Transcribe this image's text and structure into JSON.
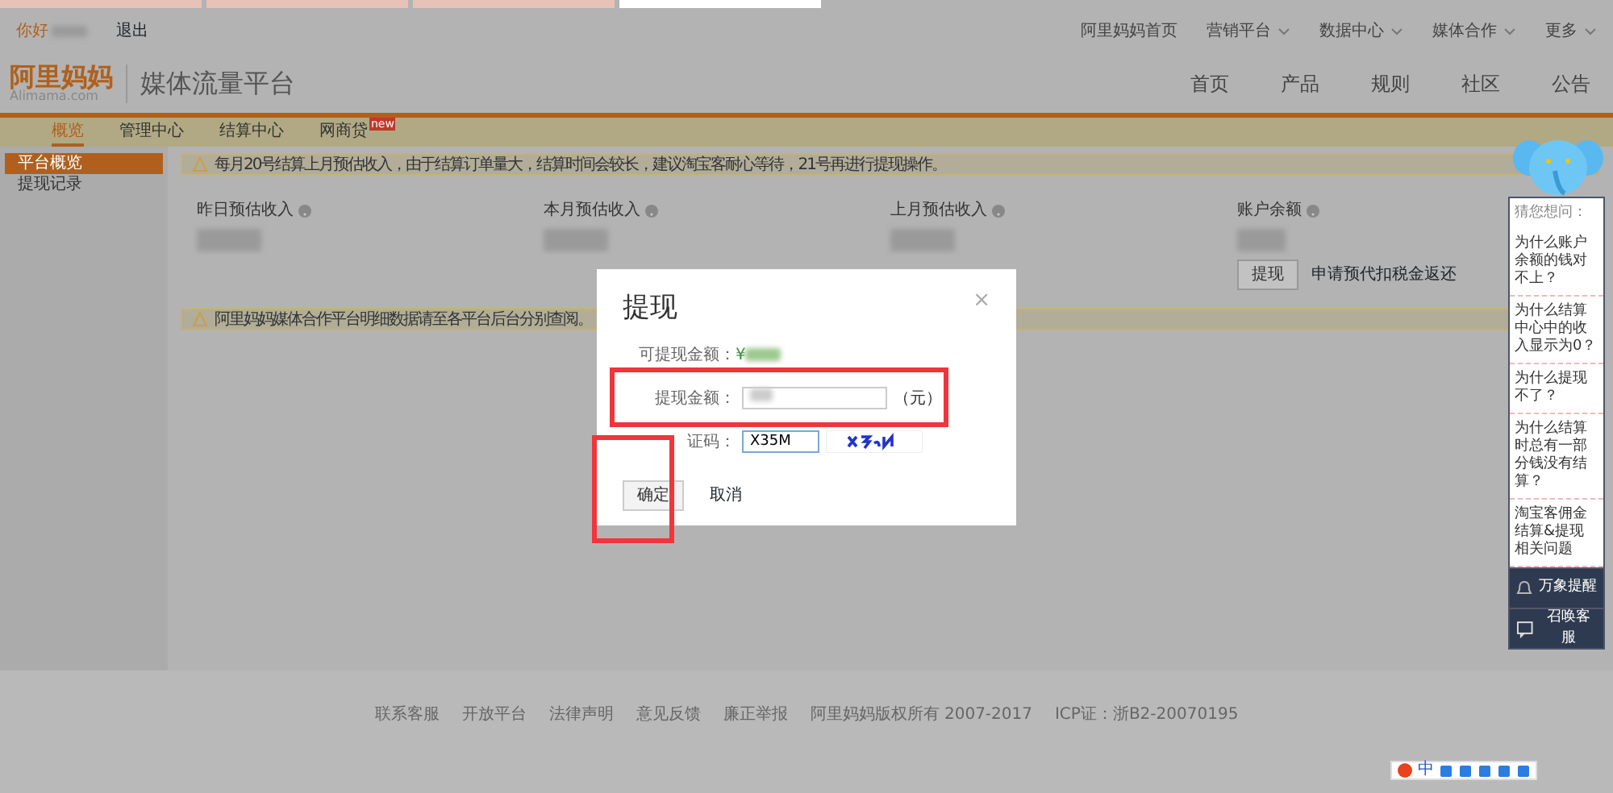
{
  "browser_tabs": [
    {
      "selected": false
    },
    {
      "selected": false
    },
    {
      "selected": false
    },
    {
      "selected": true
    }
  ],
  "top_bar": {
    "greeting": "你好",
    "logout": "退出",
    "links": [
      {
        "label": "阿里妈妈首页",
        "dropdown": false
      },
      {
        "label": "营销平台",
        "dropdown": true
      },
      {
        "label": "数据中心",
        "dropdown": true
      },
      {
        "label": "媒体合作",
        "dropdown": true
      },
      {
        "label": "更多",
        "dropdown": true
      }
    ]
  },
  "logo": {
    "brand": "阿里妈妈",
    "domain": "Alimama.com",
    "platform": "媒体流量平台"
  },
  "main_nav": [
    "首页",
    "产品",
    "规则",
    "社区",
    "公告"
  ],
  "sub_nav": [
    {
      "label": "概览",
      "selected": true
    },
    {
      "label": "管理中心",
      "selected": false
    },
    {
      "label": "结算中心",
      "selected": false
    },
    {
      "label": "网商贷",
      "selected": false,
      "badge": "new"
    }
  ],
  "sidebar": {
    "items": [
      {
        "label": "平台概览",
        "selected": true
      },
      {
        "label": "提现记录",
        "selected": false
      }
    ]
  },
  "notice": "每月20号结算上月预估收入，由于结算订单量大，结算时间会较长，建议淘宝客耐心等待，21号再进行提现操作。",
  "stats": [
    {
      "label": "昨日预估收入",
      "kind": "plain"
    },
    {
      "label": "本月预估收入",
      "kind": "plain"
    },
    {
      "label": "上月预估收入",
      "kind": "plain"
    },
    {
      "label": "账户余额",
      "kind": "balance",
      "button": "提现",
      "link": "申请预代扣税金返还"
    }
  ],
  "notice_2": "阿里妈妈媒体合作平台明细数据请至各平台后台分别查阅。",
  "modal": {
    "title": "提现",
    "close": "×",
    "available_label": "可提现金额：",
    "currency": "¥",
    "amount_label": "提现金额：",
    "amount_unit": "（元）",
    "captcha_label": "证码：",
    "captcha_value": "X35M",
    "confirm": "确定",
    "cancel": "取消"
  },
  "help_widget": {
    "title": "猜您想问：",
    "questions": [
      "为什么账户余额的钱对不上？",
      "为什么结算中心中的收入显示为0？",
      "为什么提现不了？",
      "为什么结算时总有一部分钱没有结算？",
      "淘宝客佣金结算&提现相关问题"
    ],
    "buttons": [
      {
        "label": "万象提醒",
        "kind": "reminder"
      },
      {
        "label": "召唤客服",
        "kind": "service"
      }
    ]
  },
  "footer": {
    "links": [
      "联系客服",
      "开放平台",
      "法律声明",
      "意见反馈",
      "廉正举报"
    ],
    "copyright": "阿里妈妈版权所有 2007-2017",
    "icp": "ICP证：浙B2-20070195"
  },
  "ime_toolbar": {
    "mode": "中"
  }
}
